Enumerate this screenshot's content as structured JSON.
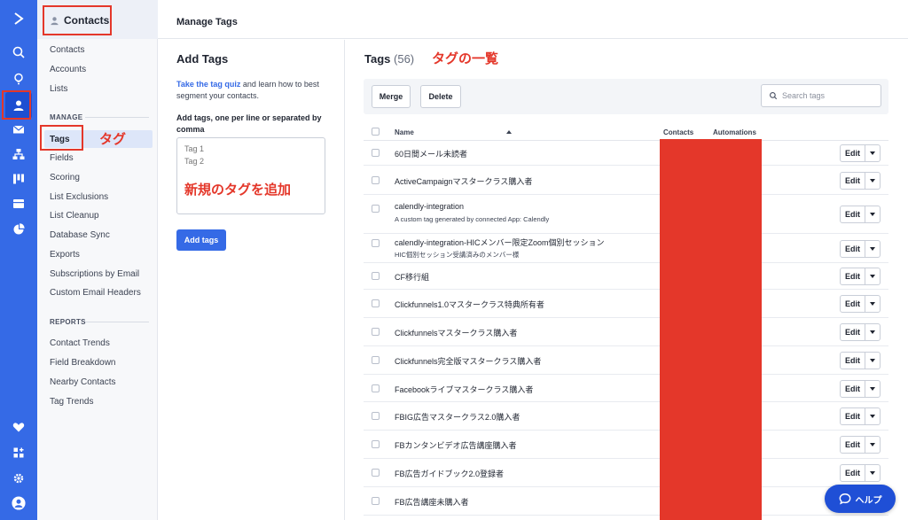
{
  "rail": {
    "items": [
      {
        "name": "logo",
        "icon": "logo-chevron-icon"
      },
      {
        "name": "search",
        "icon": "search-icon"
      },
      {
        "name": "idea",
        "icon": "lightbulb-icon"
      },
      {
        "name": "contacts",
        "icon": "person-icon",
        "active": true
      },
      {
        "name": "email",
        "icon": "envelope-icon"
      },
      {
        "name": "automations",
        "icon": "flow-icon"
      },
      {
        "name": "deals",
        "icon": "kanban-icon"
      },
      {
        "name": "website",
        "icon": "browser-icon"
      },
      {
        "name": "reports",
        "icon": "pie-chart-icon"
      },
      {
        "name": "favorites",
        "icon": "heart-icon"
      },
      {
        "name": "apps",
        "icon": "apps-icon"
      },
      {
        "name": "settings",
        "icon": "gear-icon"
      },
      {
        "name": "account",
        "icon": "avatar-icon"
      }
    ]
  },
  "sidebar": {
    "title": "Contacts",
    "items": [
      "Contacts",
      "Accounts",
      "Lists"
    ],
    "manage_label": "MANAGE",
    "manage_items": [
      "Tags",
      "Fields",
      "Scoring",
      "List Exclusions",
      "List Cleanup",
      "Database Sync",
      "Exports",
      "Subscriptions by Email",
      "Custom Email Headers"
    ],
    "reports_label": "REPORTS",
    "report_items": [
      "Contact Trends",
      "Field Breakdown",
      "Nearby Contacts",
      "Tag Trends"
    ]
  },
  "annotations": {
    "tags_note": "タグ",
    "new_tag_note": "新規のタグを追加",
    "list_note": "タグの一覧",
    "color": "#e4372a"
  },
  "header": {
    "title": "Manage Tags"
  },
  "add_tags": {
    "heading": "Add Tags",
    "quiz_link": "Take the tag quiz",
    "quiz_text": " and learn how to best segment your contacts.",
    "field_label": "Add tags, one per line or separated by comma",
    "placeholder": "Tag 1\nTag 2",
    "button": "Add tags"
  },
  "tags": {
    "heading": "Tags",
    "count": "(56)",
    "merge": "Merge",
    "delete": "Delete",
    "search_placeholder": "Search tags",
    "columns": {
      "name": "Name",
      "contacts": "Contacts",
      "automations": "Automations"
    },
    "edit_label": "Edit",
    "rows": [
      {
        "name": "60日間メール未読者",
        "sub": ""
      },
      {
        "name": "ActiveCampaignマスタークラス購入者",
        "sub": ""
      },
      {
        "name": "calendly-integration",
        "sub": "A custom tag generated by connected App: Calendly"
      },
      {
        "name": "calendly-integration-HICメンバー限定Zoom個別セッション",
        "sub": "HIC個別セッション受講済みのメンバー様"
      },
      {
        "name": "CF移行組",
        "sub": ""
      },
      {
        "name": "Clickfunnels1.0マスタークラス特典所有者",
        "sub": ""
      },
      {
        "name": "Clickfunnelsマスタークラス購入者",
        "sub": ""
      },
      {
        "name": "Clickfunnels完全版マスタークラス購入者",
        "sub": ""
      },
      {
        "name": "Facebookライブマスタークラス購入者",
        "sub": ""
      },
      {
        "name": "FBIG広告マスタークラス2.0購入者",
        "sub": ""
      },
      {
        "name": "FBカンタンビデオ広告講座購入者",
        "sub": ""
      },
      {
        "name": "FB広告ガイドブック2.0登録者",
        "sub": ""
      },
      {
        "name": "FB広告講座未購入者",
        "sub": ""
      }
    ]
  },
  "help": {
    "label": "ヘルプ",
    "icon": "chat-bubble-icon"
  }
}
